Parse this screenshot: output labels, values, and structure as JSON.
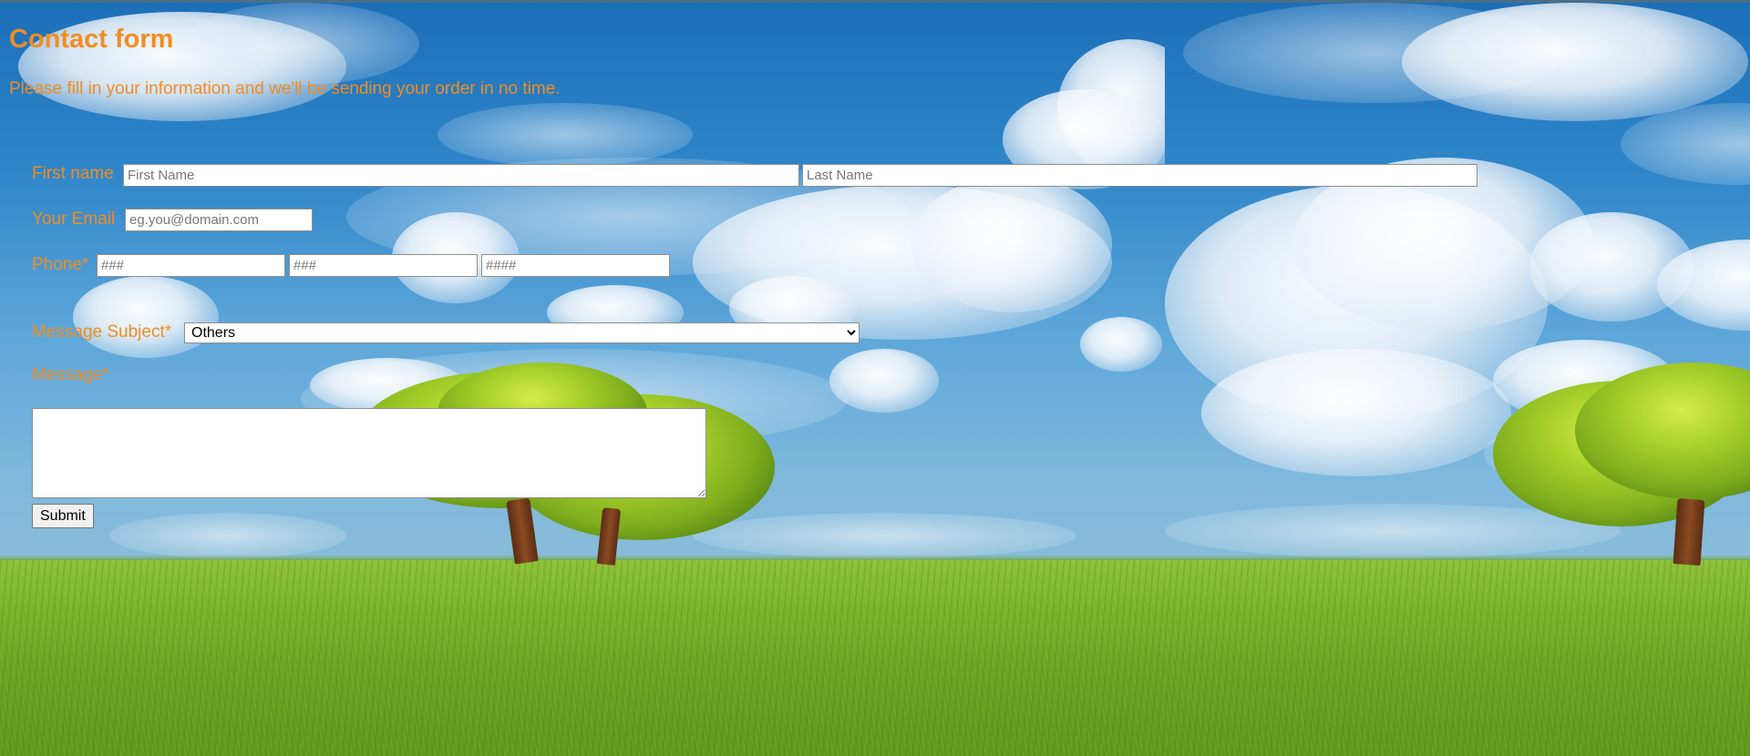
{
  "form": {
    "title": "Contact form",
    "description": "Please fill in your information and we'll be sending your order in no time.",
    "first_name": {
      "label": "First name",
      "first_placeholder": "First Name",
      "last_placeholder": "Last Name"
    },
    "email": {
      "label": "Your Email",
      "placeholder": "eg.you@domain.com"
    },
    "phone": {
      "label": "Phone*",
      "part1_placeholder": "###",
      "part2_placeholder": "###",
      "part3_placeholder": "####"
    },
    "subject": {
      "label": "Message Subject*",
      "selected": "Others"
    },
    "message": {
      "label": "Message*"
    },
    "submit_label": "Submit"
  },
  "theme": {
    "accent": "#f18c22"
  }
}
